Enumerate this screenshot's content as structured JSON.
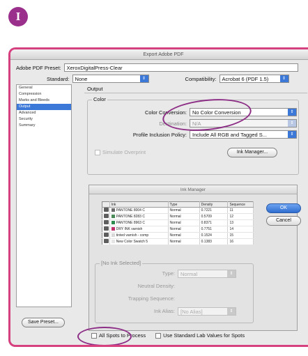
{
  "step_badge": "I",
  "dialog": {
    "title": "Export Adobe PDF",
    "preset_label": "Adobe PDF Preset:",
    "preset_value": "XeroxDigitalPress-Clear",
    "standard_label": "Standard:",
    "standard_value": "None",
    "compat_label": "Compatibility:",
    "compat_value": "Acrobat 6 (PDF 1.5)"
  },
  "sidebar": {
    "items": [
      {
        "label": "General",
        "selected": false
      },
      {
        "label": "Compression",
        "selected": false
      },
      {
        "label": "Marks and Bleeds",
        "selected": false
      },
      {
        "label": "Output",
        "selected": true
      },
      {
        "label": "Advanced",
        "selected": false
      },
      {
        "label": "Security",
        "selected": false
      },
      {
        "label": "Summary",
        "selected": false
      }
    ],
    "save_preset": "Save Preset..."
  },
  "output": {
    "heading": "Output",
    "color_group": "Color",
    "conversion_label": "Color Conversion:",
    "conversion_value": "No Color Conversion",
    "destination_label": "Destination:",
    "destination_value": "N/A",
    "profile_label": "Profile Inclusion Policy:",
    "profile_value": "Include All RGB and Tagged S...",
    "simulate_overprint": "Simulate Overprint",
    "ink_manager_button": "Ink Manager..."
  },
  "ink_manager": {
    "title": "Ink Manager",
    "columns": [
      "Ink",
      "Type",
      "Density",
      "Sequence"
    ],
    "rows": [
      {
        "name": "PANTONE 8004 C",
        "type": "Normal",
        "density": "0.7221",
        "sequence": "11",
        "swatch": "#6b6b6b"
      },
      {
        "name": "PANTONE 8283 C",
        "type": "Normal",
        "density": "0.5709",
        "sequence": "12",
        "swatch": "#4b8b5a"
      },
      {
        "name": "PANTONE 8963 C",
        "type": "Normal",
        "density": "0.8371",
        "sequence": "13",
        "swatch": "#2e8c4f"
      },
      {
        "name": "DRY INK varnish",
        "type": "Normal",
        "density": "0.7751",
        "sequence": "14",
        "swatch": "#c0306d"
      },
      {
        "name": "tinted varnish - comp",
        "type": "Normal",
        "density": "0.1524",
        "sequence": "15",
        "swatch": "#d8d8d8"
      },
      {
        "name": "New Color Swatch 5",
        "type": "Normal",
        "density": "0.1383",
        "sequence": "16",
        "swatch": "#e5e5e5"
      }
    ],
    "ok_button": "OK",
    "cancel_button": "Cancel",
    "selected_group": "[No Ink Selected]",
    "type_label": "Type:",
    "type_value": "Normal",
    "neutral_density_label": "Neutral Density:",
    "trapping_sequence_label": "Trapping Sequence:",
    "ink_alias_label": "Ink Alias:",
    "ink_alias_value": "[No Alias]",
    "all_spots_label": "All Spots to Process",
    "use_lab_label": "Use Standard Lab Values for Spots"
  },
  "colors": {
    "accent": "#3c78d8",
    "highlight_ellipse": "#8d2e86",
    "frame": "#d6407f",
    "badge": "#9a2f8c"
  }
}
